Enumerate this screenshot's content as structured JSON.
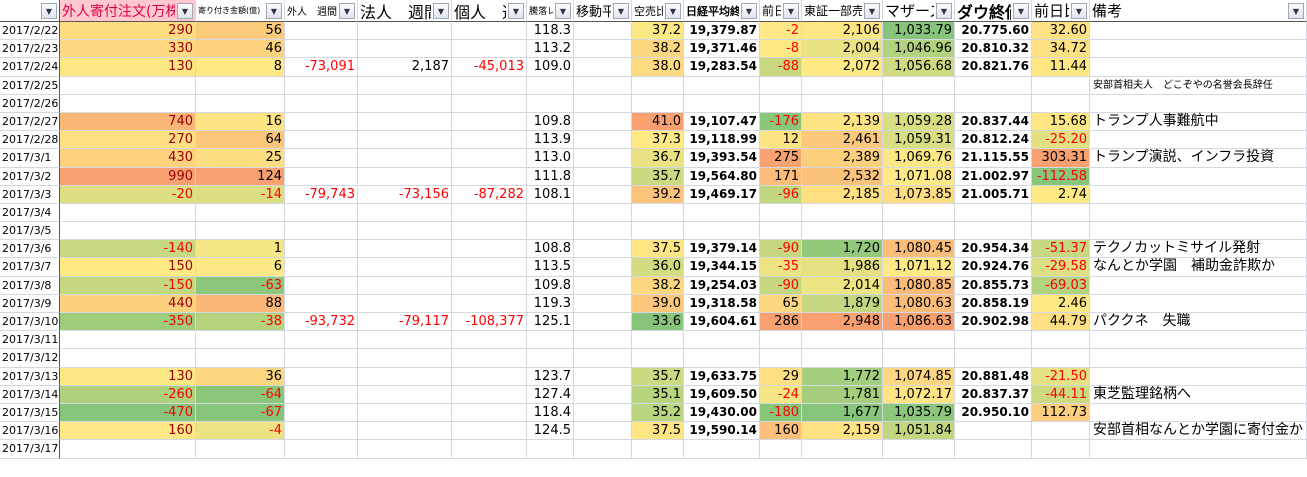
{
  "colors": {
    "scale_low": "#86c57a",
    "scale_mid": "#ffe985",
    "scale_high": "#f8a070",
    "header_highlight_bg": "#ffc7ce",
    "header_highlight_text": "#e0004a",
    "negative_text": "#ff0000",
    "positive_text_col1": "#9c0006"
  },
  "headers": [
    {
      "label": "",
      "size": 11
    },
    {
      "label": "外人寄付注文(万株)",
      "size": 14,
      "highlight": true
    },
    {
      "label": "寄り付き金額(億)",
      "size": 8
    },
    {
      "label": "外人　週間差",
      "size": 10
    },
    {
      "label": "法人　週間",
      "size": 16
    },
    {
      "label": "個人　週",
      "size": 16
    },
    {
      "label": "騰落レシオ",
      "size": 9
    },
    {
      "label": "移動平",
      "size": 13
    },
    {
      "label": "空売比率",
      "size": 11
    },
    {
      "label": "日経平均終値",
      "size": 11,
      "bold": true
    },
    {
      "label": "前日比",
      "size": 12
    },
    {
      "label": "東証一部売",
      "size": 12
    },
    {
      "label": "マザーズ",
      "size": 15
    },
    {
      "label": "ダウ終値",
      "size": 16,
      "bold": true
    },
    {
      "label": "前日比",
      "size": 15
    },
    {
      "label": "備考",
      "size": 15
    }
  ],
  "heat_columns": [
    1,
    2,
    8,
    10,
    11,
    12,
    14
  ],
  "rows": [
    [
      "2017/2/22",
      "290",
      "56",
      "",
      "",
      "",
      "118.3",
      "",
      "37.2",
      "19,379.87",
      "-2",
      "2,106",
      "1,033.79",
      "20.775.60",
      "32.60",
      ""
    ],
    [
      "2017/2/23",
      "330",
      "46",
      "",
      "",
      "",
      "113.2",
      "",
      "38.2",
      "19,371.46",
      "-8",
      "2,004",
      "1,046.96",
      "20.810.32",
      "34.72",
      ""
    ],
    [
      "2017/2/24",
      "130",
      "8",
      "-73,091",
      "2,187",
      "-45,013",
      "109.0",
      "",
      "38.0",
      "19,283.54",
      "-88",
      "2,072",
      "1,056.68",
      "20.821.76",
      "11.44",
      ""
    ],
    [
      "2017/2/25",
      "",
      "",
      "",
      "",
      "",
      "",
      "",
      "",
      "",
      "",
      "",
      "",
      "",
      "",
      "安部首相夫人　どこぞやの名誉会長辞任"
    ],
    [
      "2017/2/26",
      "",
      "",
      "",
      "",
      "",
      "",
      "",
      "",
      "",
      "",
      "",
      "",
      "",
      "",
      ""
    ],
    [
      "2017/2/27",
      "740",
      "16",
      "",
      "",
      "",
      "109.8",
      "",
      "41.0",
      "19,107.47",
      "-176",
      "2,139",
      "1,059.28",
      "20.837.44",
      "15.68",
      "トランプ人事難航中"
    ],
    [
      "2017/2/28",
      "270",
      "64",
      "",
      "",
      "",
      "113.9",
      "",
      "37.3",
      "19,118.99",
      "12",
      "2,461",
      "1,059.31",
      "20.812.24",
      "-25.20",
      ""
    ],
    [
      "2017/3/1",
      "430",
      "25",
      "",
      "",
      "",
      "113.0",
      "",
      "36.7",
      "19,393.54",
      "275",
      "2,389",
      "1,069.76",
      "21.115.55",
      "303.31",
      "トランプ演説、インフラ投資"
    ],
    [
      "2017/3/2",
      "990",
      "124",
      "",
      "",
      "",
      "111.8",
      "",
      "35.7",
      "19,564.80",
      "171",
      "2,532",
      "1,071.08",
      "21.002.97",
      "-112.58",
      ""
    ],
    [
      "2017/3/3",
      "-20",
      "-14",
      "-79,743",
      "-73,156",
      "-87,282",
      "108.1",
      "",
      "39.2",
      "19,469.17",
      "-96",
      "2,185",
      "1,073.85",
      "21.005.71",
      "2.74",
      ""
    ],
    [
      "2017/3/4",
      "",
      "",
      "",
      "",
      "",
      "",
      "",
      "",
      "",
      "",
      "",
      "",
      "",
      "",
      ""
    ],
    [
      "2017/3/5",
      "",
      "",
      "",
      "",
      "",
      "",
      "",
      "",
      "",
      "",
      "",
      "",
      "",
      "",
      ""
    ],
    [
      "2017/3/6",
      "-140",
      "1",
      "",
      "",
      "",
      "108.8",
      "",
      "37.5",
      "19,379.14",
      "-90",
      "1,720",
      "1,080.45",
      "20.954.34",
      "-51.37",
      "テクノカットミサイル発射"
    ],
    [
      "2017/3/7",
      "150",
      "6",
      "",
      "",
      "",
      "113.5",
      "",
      "36.0",
      "19,344.15",
      "-35",
      "1,986",
      "1,071.12",
      "20.924.76",
      "-29.58",
      "なんとか学園　補助金詐欺か"
    ],
    [
      "2017/3/8",
      "-150",
      "-63",
      "",
      "",
      "",
      "109.8",
      "",
      "38.2",
      "19,254.03",
      "-90",
      "2,014",
      "1,080.85",
      "20.855.73",
      "-69.03",
      ""
    ],
    [
      "2017/3/9",
      "440",
      "88",
      "",
      "",
      "",
      "119.3",
      "",
      "39.0",
      "19,318.58",
      "65",
      "1,879",
      "1,080.63",
      "20.858.19",
      "2.46",
      ""
    ],
    [
      "2017/3/10",
      "-350",
      "-38",
      "-93,732",
      "-79,117",
      "-108,377",
      "125.1",
      "",
      "33.6",
      "19,604.61",
      "286",
      "2,948",
      "1,086.63",
      "20.902.98",
      "44.79",
      "パククネ　失職"
    ],
    [
      "2017/3/11",
      "",
      "",
      "",
      "",
      "",
      "",
      "",
      "",
      "",
      "",
      "",
      "",
      "",
      "",
      ""
    ],
    [
      "2017/3/12",
      "",
      "",
      "",
      "",
      "",
      "",
      "",
      "",
      "",
      "",
      "",
      "",
      "",
      "",
      ""
    ],
    [
      "2017/3/13",
      "130",
      "36",
      "",
      "",
      "",
      "123.7",
      "",
      "35.7",
      "19,633.75",
      "29",
      "1,772",
      "1,074.85",
      "20.881.48",
      "-21.50",
      ""
    ],
    [
      "2017/3/14",
      "-260",
      "-64",
      "",
      "",
      "",
      "127.4",
      "",
      "35.1",
      "19,609.50",
      "-24",
      "1,781",
      "1,072.17",
      "20.837.37",
      "-44.11",
      "東芝監理銘柄へ"
    ],
    [
      "2017/3/15",
      "-470",
      "-67",
      "",
      "",
      "",
      "118.4",
      "",
      "35.2",
      "19,430.00",
      "-180",
      "1,677",
      "1,035.79",
      "20.950.10",
      "112.73",
      ""
    ],
    [
      "2017/3/16",
      "160",
      "-4",
      "",
      "",
      "",
      "124.5",
      "",
      "37.5",
      "19,590.14",
      "160",
      "2,159",
      "1,051.84",
      "",
      "",
      "安部首相なんとか学園に寄付金か"
    ],
    [
      "2017/3/17",
      "",
      "",
      "",
      "",
      "",
      "",
      "",
      "",
      "",
      "",
      "",
      "",
      "",
      "",
      ""
    ]
  ]
}
